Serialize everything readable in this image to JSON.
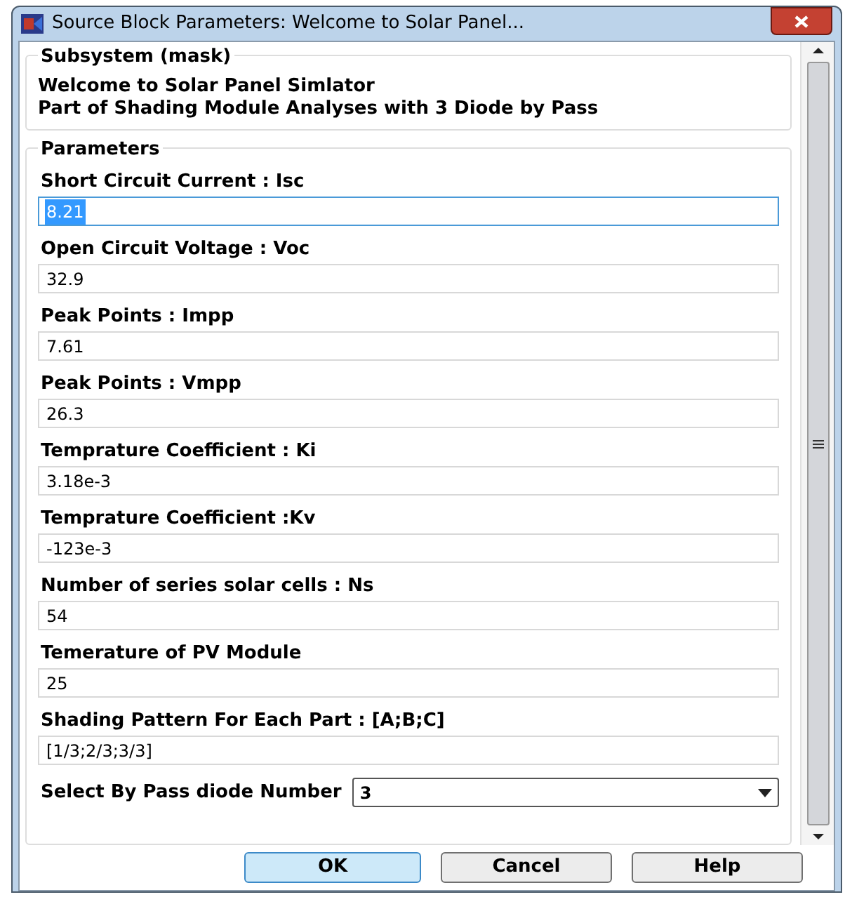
{
  "window": {
    "title": "Source Block Parameters: Welcome to Solar Panel..."
  },
  "description": {
    "heading": "Subsystem (mask)",
    "lines": [
      "Welcome to Solar Panel Simlator",
      "Part of Shading Module Analyses with 3 Diode by Pass"
    ]
  },
  "parameters": {
    "heading": "Parameters",
    "fields": [
      {
        "kind": "text",
        "label": "Short Circuit Current : Isc",
        "value": "8.21",
        "focused": true
      },
      {
        "kind": "text",
        "label": "Open Circuit Voltage : Voc",
        "value": "32.9",
        "focused": false
      },
      {
        "kind": "text",
        "label": "Peak Points : Impp",
        "value": "7.61",
        "focused": false
      },
      {
        "kind": "text",
        "label": "Peak Points : Vmpp",
        "value": "26.3",
        "focused": false
      },
      {
        "kind": "text",
        "label": "Temprature Coefficient : Ki",
        "value": "3.18e-3",
        "focused": false
      },
      {
        "kind": "text",
        "label": "Temprature Coefficient :Kv",
        "value": "-123e-3",
        "focused": false
      },
      {
        "kind": "text",
        "label": "Number of series solar cells : Ns",
        "value": "54",
        "focused": false
      },
      {
        "kind": "text",
        "label": "Temerature of PV Module",
        "value": "25",
        "focused": false
      },
      {
        "kind": "text",
        "label": "Shading Pattern For Each Part : [A;B;C]",
        "value": "[1/3;2/3;3/3]",
        "focused": false
      },
      {
        "kind": "dropdown",
        "label": "Select By Pass diode Number",
        "value": "3",
        "focused": false
      }
    ]
  },
  "buttons": [
    {
      "label": "OK",
      "default": true
    },
    {
      "label": "Cancel",
      "default": false
    },
    {
      "label": "Help",
      "default": false
    }
  ]
}
